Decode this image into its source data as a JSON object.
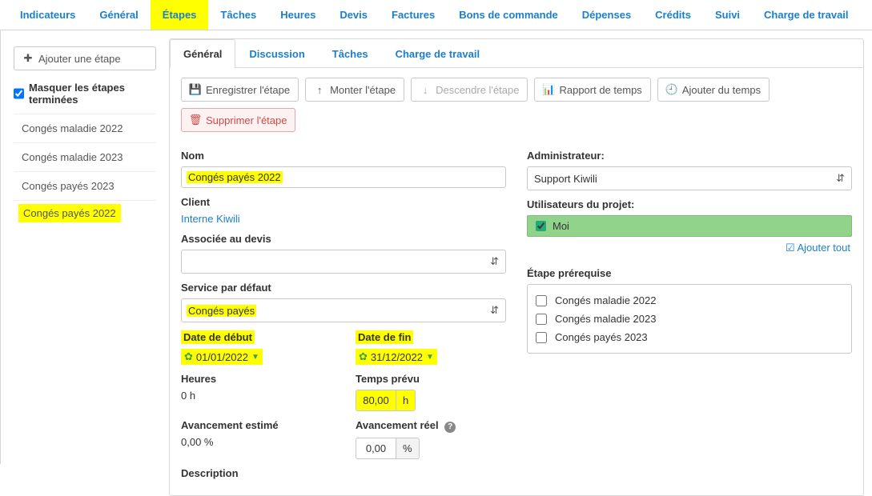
{
  "topnav": {
    "items": [
      "Indicateurs",
      "Général",
      "Étapes",
      "Tâches",
      "Heures",
      "Devis",
      "Factures",
      "Bons de commande",
      "Dépenses",
      "Crédits",
      "Suivi",
      "Charge de travail"
    ],
    "active_index": 2
  },
  "sidebar": {
    "add_label": "Ajouter une étape",
    "hide_done_label": "Masquer les étapes terminées",
    "hide_done_checked": true,
    "items": [
      "Congés maladie 2022",
      "Congés maladie 2023",
      "Congés payés 2023",
      "Congés payés 2022"
    ],
    "highlight_index": 3
  },
  "maintabs": {
    "items": [
      "Général",
      "Discussion",
      "Tâches",
      "Charge de travail"
    ],
    "active_index": 0
  },
  "toolbar": {
    "save": "Enregistrer l'étape",
    "up": "Monter l'étape",
    "down": "Descendre l'étape",
    "report": "Rapport de temps",
    "addtime": "Ajouter du temps",
    "delete": "Supprimer l'étape"
  },
  "left": {
    "name_label": "Nom",
    "name_value": "Congés payés 2022",
    "client_label": "Client",
    "client_value": "Interne Kiwili",
    "quote_label": "Associée au devis",
    "quote_value": "",
    "service_label": "Service par défaut",
    "service_value": "Congés payés",
    "start_label": "Date de début",
    "start_value": "01/01/2022",
    "end_label": "Date de fin",
    "end_value": "31/12/2022",
    "hours_label": "Heures",
    "hours_value": "0 h",
    "planned_label": "Temps prévu",
    "planned_value": "80,00",
    "planned_unit": "h",
    "estprog_label": "Avancement estimé",
    "estprog_value": "0,00 %",
    "realprog_label": "Avancement réel",
    "realprog_value": "0,00",
    "realprog_unit": "%",
    "desc_label": "Description"
  },
  "right": {
    "admin_label": "Administrateur:",
    "admin_value": "Support Kiwili",
    "users_label": "Utilisateurs du projet:",
    "users_me": "Moi",
    "add_all": "Ajouter tout",
    "prereq_label": "Étape prérequise",
    "prereq_items": [
      "Congés maladie 2022",
      "Congés maladie 2023",
      "Congés payés 2023"
    ]
  }
}
